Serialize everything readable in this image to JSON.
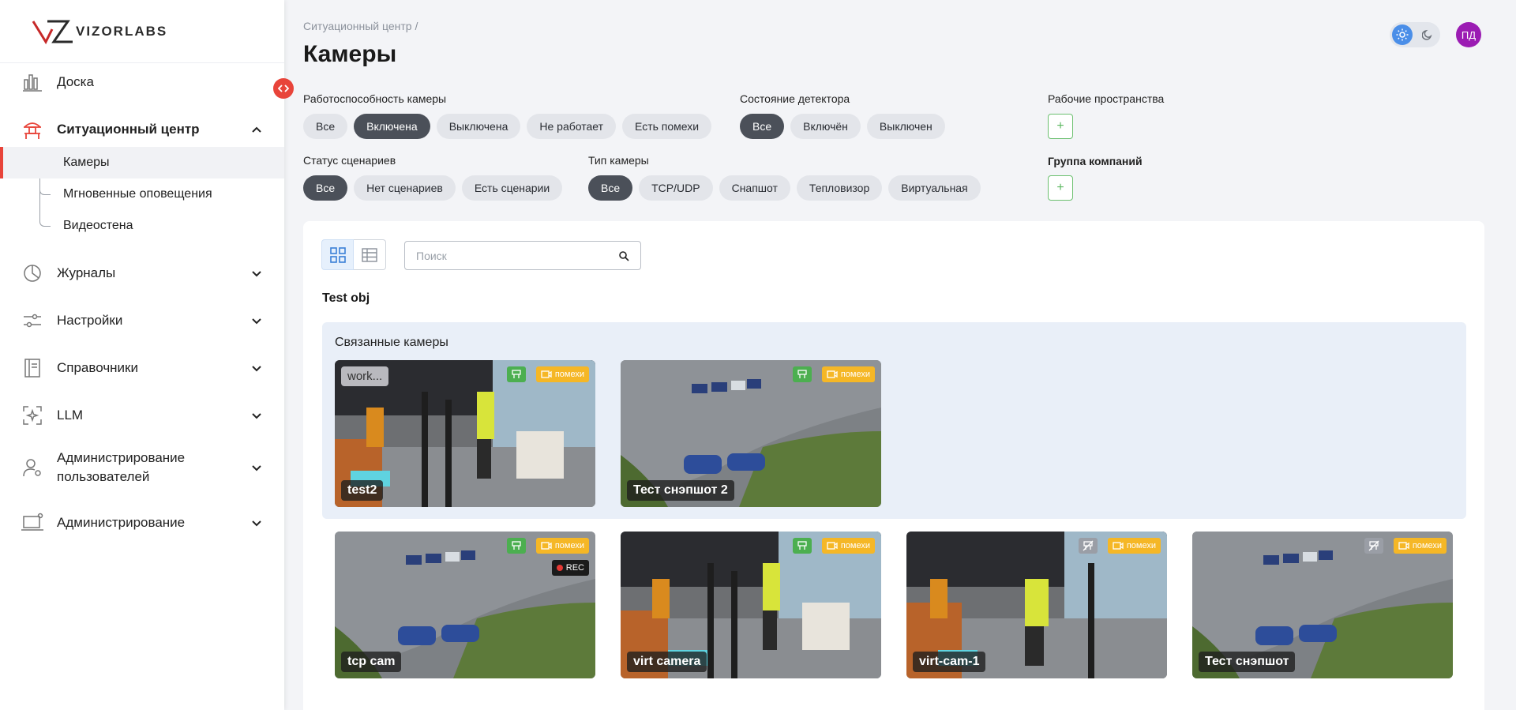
{
  "brand": {
    "name": "VIZORLABS"
  },
  "sidebar": {
    "items": [
      {
        "label": "Доска",
        "icon": "chart-bar-icon"
      },
      {
        "label": "Ситуационный центр",
        "icon": "situation-center-icon",
        "expanded": true
      },
      {
        "label": "Журналы",
        "icon": "pie-chart-icon"
      },
      {
        "label": "Настройки",
        "icon": "sliders-icon"
      },
      {
        "label": "Справочники",
        "icon": "book-icon"
      },
      {
        "label": "LLM",
        "icon": "ai-scan-icon"
      },
      {
        "label": "Администрирование пользователей",
        "icon": "user-settings-icon"
      },
      {
        "label": "Администрирование",
        "icon": "laptop-settings-icon"
      }
    ],
    "subitems": [
      {
        "label": "Камеры",
        "active": true
      },
      {
        "label": "Мгновенные оповещения"
      },
      {
        "label": "Видеостена"
      }
    ]
  },
  "header": {
    "breadcrumb": "Ситуационный центр /",
    "title": "Камеры",
    "avatar_initials": "ПД",
    "theme": "light"
  },
  "filters": {
    "camera_health": {
      "label": "Работоспособность камеры",
      "options": [
        "Все",
        "Включена",
        "Выключена",
        "Не работает",
        "Есть помехи"
      ],
      "selected": "Включена"
    },
    "detector_state": {
      "label": "Состояние детектора",
      "options": [
        "Все",
        "Включён",
        "Выключен"
      ],
      "selected": "Все"
    },
    "workspaces": {
      "label": "Рабочие пространства"
    },
    "scenario_status": {
      "label": "Статус сценариев",
      "options": [
        "Все",
        "Нет сценариев",
        "Есть сценарии"
      ],
      "selected": "Все"
    },
    "camera_type": {
      "label": "Тип камеры",
      "options": [
        "Все",
        "TCP/UDP",
        "Снапшот",
        "Тепловизор",
        "Виртуальная"
      ],
      "selected": "Все"
    },
    "company_group": {
      "label": "Группа компаний"
    },
    "add_symbol": "+"
  },
  "toolbar": {
    "search_placeholder": "Поиск",
    "view_mode": "grid"
  },
  "group": {
    "name": "Test obj",
    "linked_title": "Связанные камеры",
    "linked_cameras": [
      {
        "name": "test2",
        "template": "work...",
        "scene": "office",
        "detector": "on",
        "noise_label": "помехи"
      },
      {
        "name": "Тест снэпшот 2",
        "scene": "parking",
        "detector": "on",
        "noise_label": "помехи"
      }
    ],
    "cameras": [
      {
        "name": "tcp cam",
        "scene": "parking",
        "detector": "on",
        "noise_label": "помехи",
        "rec_label": "REC"
      },
      {
        "name": "virt camera",
        "scene": "office",
        "detector": "on",
        "noise_label": "помехи"
      },
      {
        "name": "virt-cam-1",
        "scene": "office",
        "detector": "off",
        "noise_label": "помехи"
      },
      {
        "name": "Тест снэпшот",
        "scene": "parking",
        "detector": "off",
        "noise_label": "помехи"
      }
    ]
  },
  "colors": {
    "accent": "#e8443a",
    "chip_selected": "#4b5059",
    "detector_on": "#4caf50",
    "noise_badge": "#f5b726",
    "avatar": "#9b1cb3",
    "linked_bg": "#e9eff8"
  }
}
